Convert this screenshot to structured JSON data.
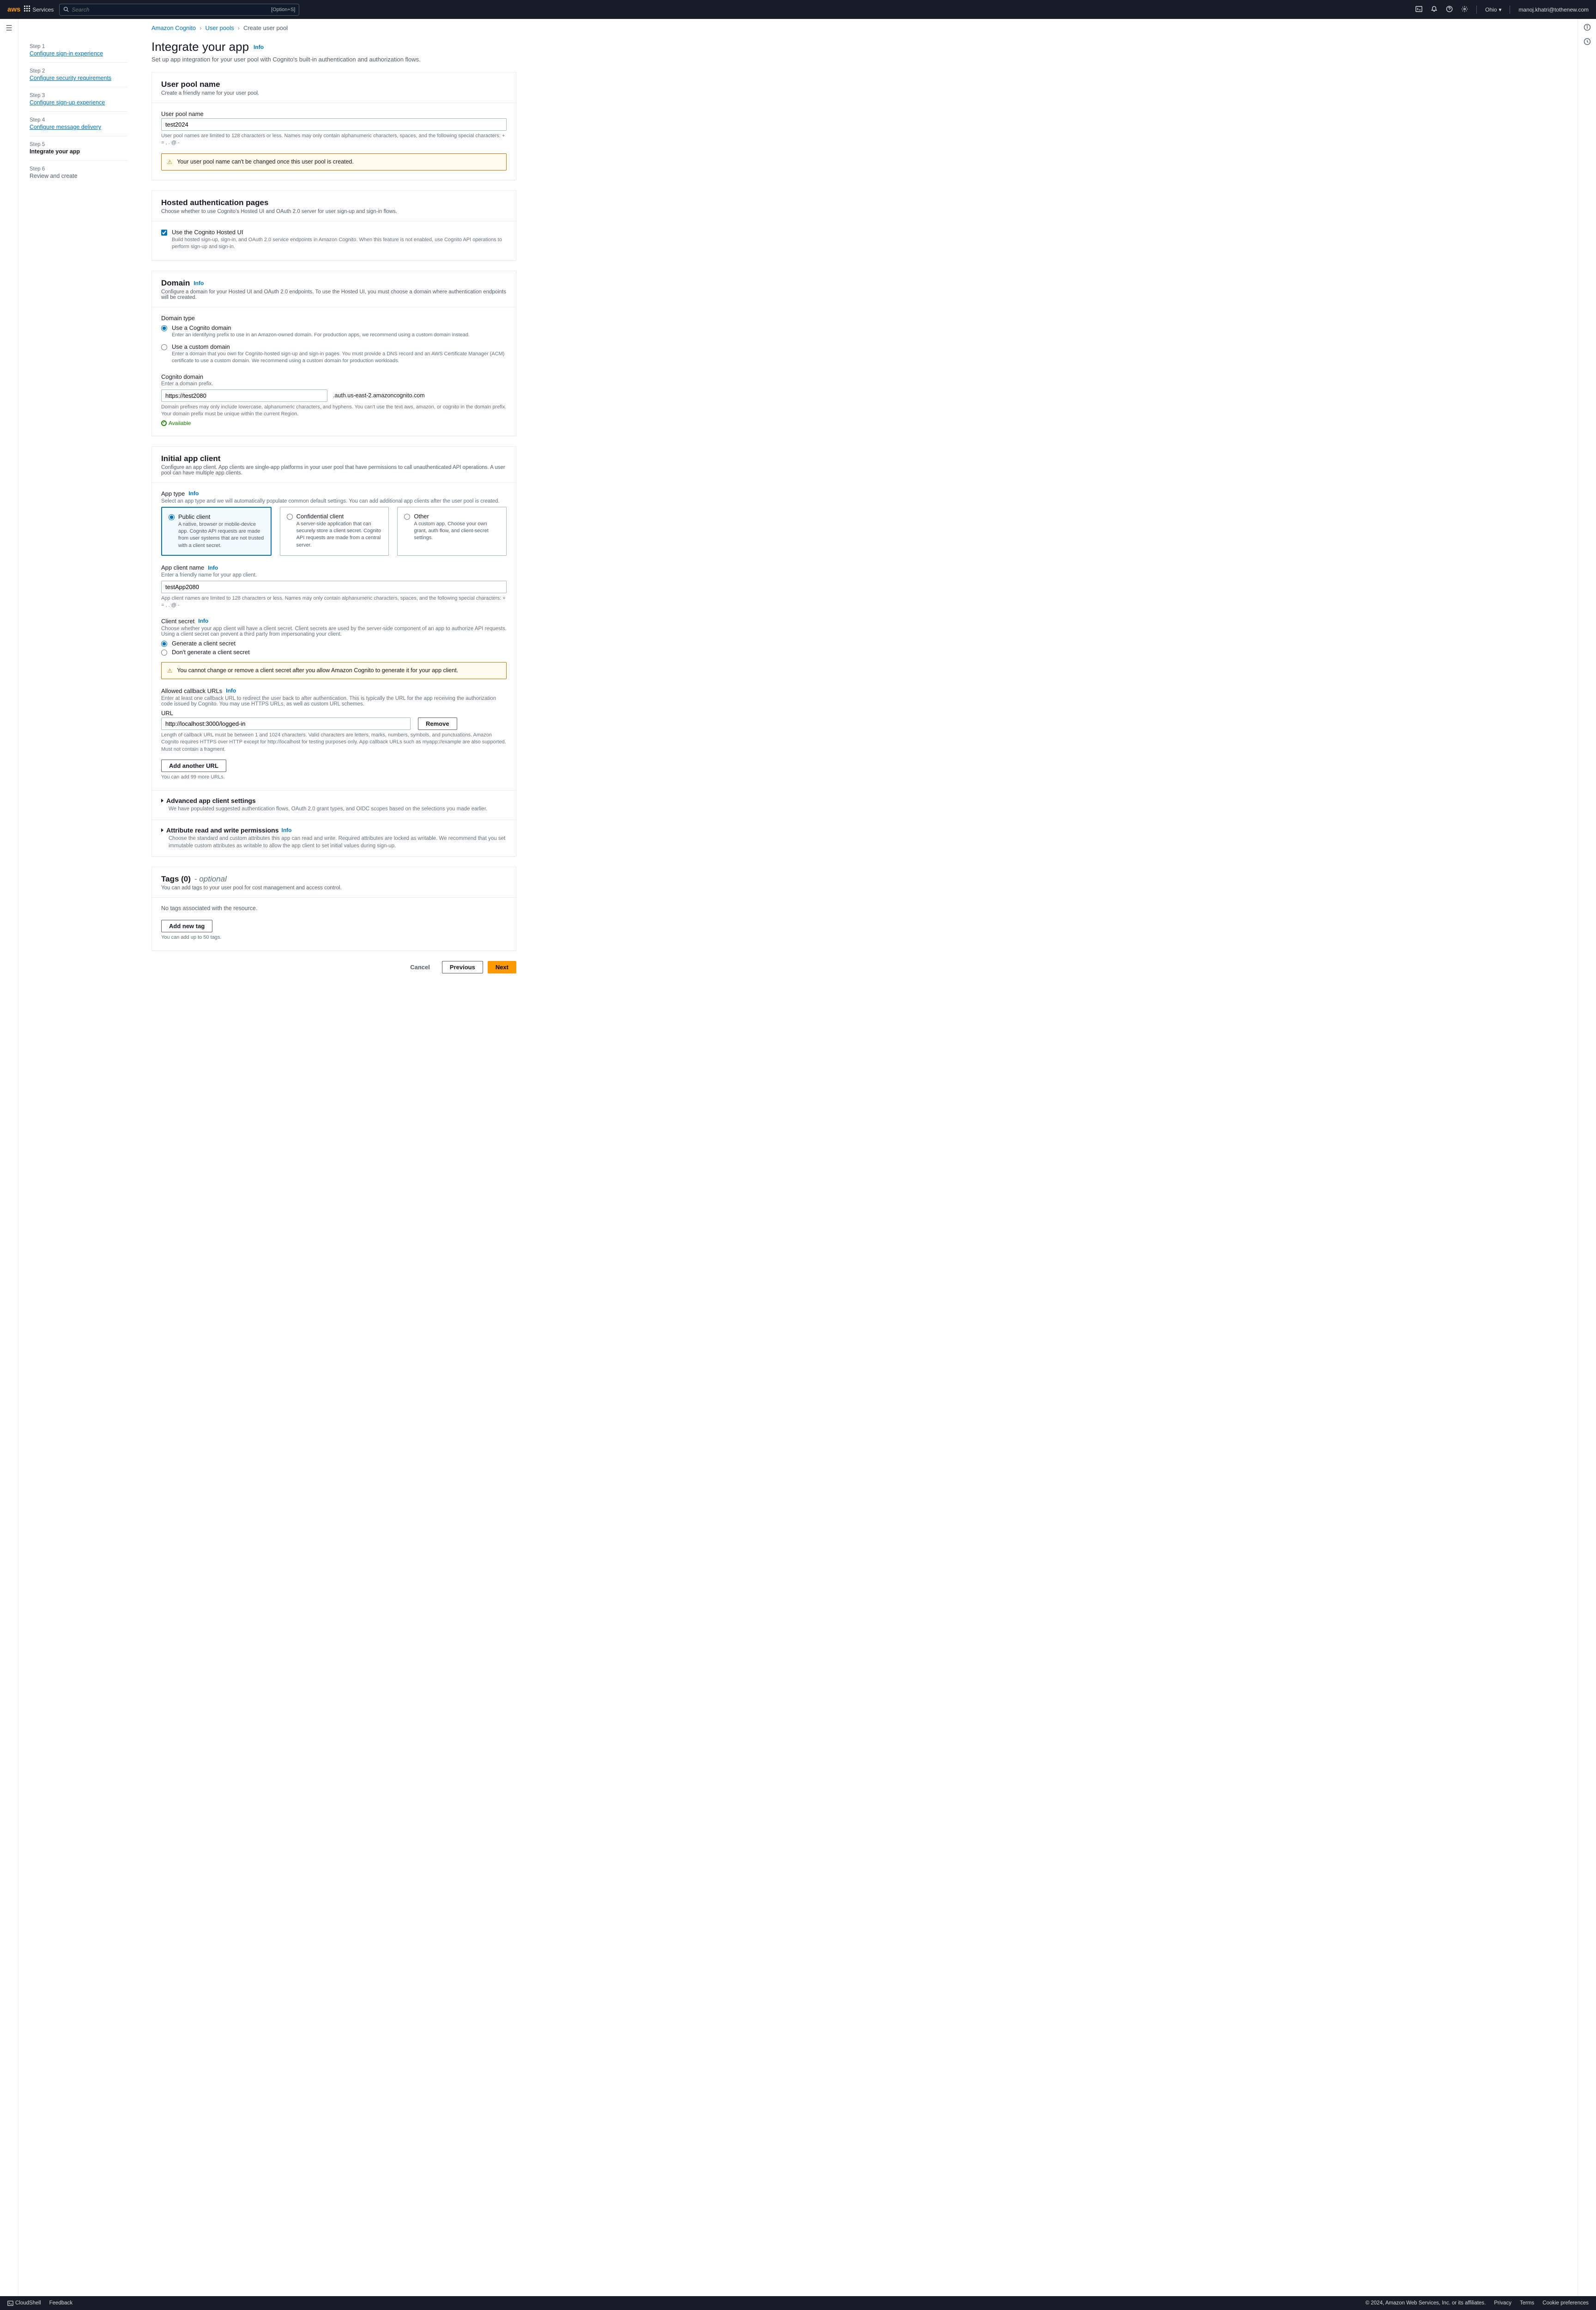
{
  "topnav": {
    "logo": "aws",
    "services": "Services",
    "search_placeholder": "Search",
    "shortcut": "[Option+S]",
    "region": "Ohio",
    "user": "manoj.khatri@tothenew.com"
  },
  "breadcrumb": {
    "root": "Amazon Cognito",
    "pools": "User pools",
    "current": "Create user pool"
  },
  "steps": [
    {
      "label": "Step 1",
      "title": "Configure sign-in experience",
      "state": "link"
    },
    {
      "label": "Step 2",
      "title": "Configure security requirements",
      "state": "link"
    },
    {
      "label": "Step 3",
      "title": "Configure sign-up experience",
      "state": "link"
    },
    {
      "label": "Step 4",
      "title": "Configure message delivery",
      "state": "link"
    },
    {
      "label": "Step 5",
      "title": "Integrate your app",
      "state": "current"
    },
    {
      "label": "Step 6",
      "title": "Review and create",
      "state": "future"
    }
  ],
  "page": {
    "title": "Integrate your app",
    "info": "Info",
    "sub": "Set up app integration for your user pool with Cognito's built-in authentication and authorization flows."
  },
  "userpool": {
    "header": "User pool name",
    "header_sub": "Create a friendly name for your user pool.",
    "label": "User pool name",
    "value": "test2024",
    "help": "User pool names are limited to 128 characters or less. Names may only contain alphanumeric characters, spaces, and the following special characters: + = , . @ -",
    "warn": "Your user pool name can't be changed once this user pool is created."
  },
  "hosted": {
    "header": "Hosted authentication pages",
    "header_sub": "Choose whether to use Cognito's Hosted UI and OAuth 2.0 server for user sign-up and sign-in flows.",
    "cb_title": "Use the Cognito Hosted UI",
    "cb_desc": "Build hosted sign-up, sign-in, and OAuth 2.0 service endpoints in Amazon Cognito. When this feature is not enabled, use Cognito API operations to perform sign-up and sign-in."
  },
  "domain": {
    "header": "Domain",
    "header_sub": "Configure a domain for your Hosted UI and OAuth 2.0 endpoints. To use the Hosted UI, you must choose a domain where authentication endpoints will be created.",
    "type_label": "Domain type",
    "r1_title": "Use a Cognito domain",
    "r1_desc": "Enter an identifying prefix to use in an Amazon-owned domain. For production apps, we recommend using a custom domain instead.",
    "r2_title": "Use a custom domain",
    "r2_desc": "Enter a domain that you own for Cognito-hosted sign-up and sign-in pages. You must provide a DNS record and an AWS Certificate Manager (ACM) certificate to use a custom domain. We recommend using a custom domain for production workloads.",
    "prefix_label": "Cognito domain",
    "prefix_desc": "Enter a domain prefix.",
    "prefix_value": "https://test2080",
    "suffix": ".auth.us-east-2.amazoncognito.com",
    "prefix_help": "Domain prefixes may only include lowercase, alphanumeric characters, and hyphens. You can't use the text aws, amazon, or cognito in the domain prefix. Your domain prefix must be unique within the current Region.",
    "available": "Available"
  },
  "appclient": {
    "header": "Initial app client",
    "header_sub": "Configure an app client. App clients are single-app platforms in your user pool that have permissions to call unauthenticated API operations. A user pool can have multiple app clients.",
    "apptype_label": "App type",
    "apptype_desc": "Select an app type and we will automatically populate common default settings. You can add additional app clients after the user pool is created.",
    "tiles": [
      {
        "title": "Public client",
        "desc": "A native, browser or mobile-device app. Cognito API requests are made from user systems that are not trusted with a client secret.",
        "selected": true
      },
      {
        "title": "Confidential client",
        "desc": "A server-side application that can securely store a client secret. Cognito API requests are made from a central server.",
        "selected": false
      },
      {
        "title": "Other",
        "desc": "A custom app. Choose your own grant, auth flow, and client-secret settings.",
        "selected": false
      }
    ],
    "name_label": "App client name",
    "name_desc": "Enter a friendly name for your app client.",
    "name_value": "testApp2080",
    "name_help": "App client names are limited to 128 characters or less. Names may only contain alphanumeric characters, spaces, and the following special characters: + = , . @ -",
    "secret_label": "Client secret",
    "secret_desc": "Choose whether your app client will have a client secret. Client secrets are used by the server-side component of an app to authorize API requests. Using a client secret can prevent a third party from impersonating your client.",
    "secret_r1": "Generate a client secret",
    "secret_r2": "Don't generate a client secret",
    "secret_warn": "You cannot change or remove a client secret after you allow Amazon Cognito to generate it for your app client.",
    "callback_label": "Allowed callback URLs",
    "callback_desc": "Enter at least one callback URL to redirect the user back to after authentication. This is typically the URL for the app receiving the authorization code issued by Cognito. You may use HTTPS URLs, as well as custom URL schemes.",
    "url_label": "URL",
    "url_value": "http://localhost:3000/logged-in",
    "remove_btn": "Remove",
    "url_help": "Length of callback URL must be between 1 and 1024 characters. Valid characters are letters, marks, numbers, symbols, and punctuations. Amazon Cognito requires HTTPS over HTTP except for http://localhost for testing purposes only. App callback URLs such as myapp://example are also supported. Must not contain a fragment.",
    "add_url_btn": "Add another URL",
    "add_url_help": "You can add 99 more URLs.",
    "adv_title": "Advanced app client settings",
    "adv_desc": "We have populated suggested authentication flows, OAuth 2.0 grant types, and OIDC scopes based on the selections you made earlier.",
    "attr_title": "Attribute read and write permissions",
    "attr_desc": "Choose the standard and custom attributes this app can read and write. Required attributes are locked as writable. We recommend that you set immutable custom attributes as writable to allow the app client to set initial values during sign-up."
  },
  "tags": {
    "header_prefix": "Tags (0)",
    "header_suffix": " - optional",
    "sub": "You can add tags to your user pool for cost management and access control.",
    "empty": "No tags associated with the resource.",
    "add_btn": "Add new tag",
    "help": "You can add up to 50 tags."
  },
  "footer_btns": {
    "cancel": "Cancel",
    "previous": "Previous",
    "next": "Next"
  },
  "bottombar": {
    "cloudshell": "CloudShell",
    "feedback": "Feedback",
    "copyright": "© 2024, Amazon Web Services, Inc. or its affiliates.",
    "privacy": "Privacy",
    "terms": "Terms",
    "cookie": "Cookie preferences"
  }
}
